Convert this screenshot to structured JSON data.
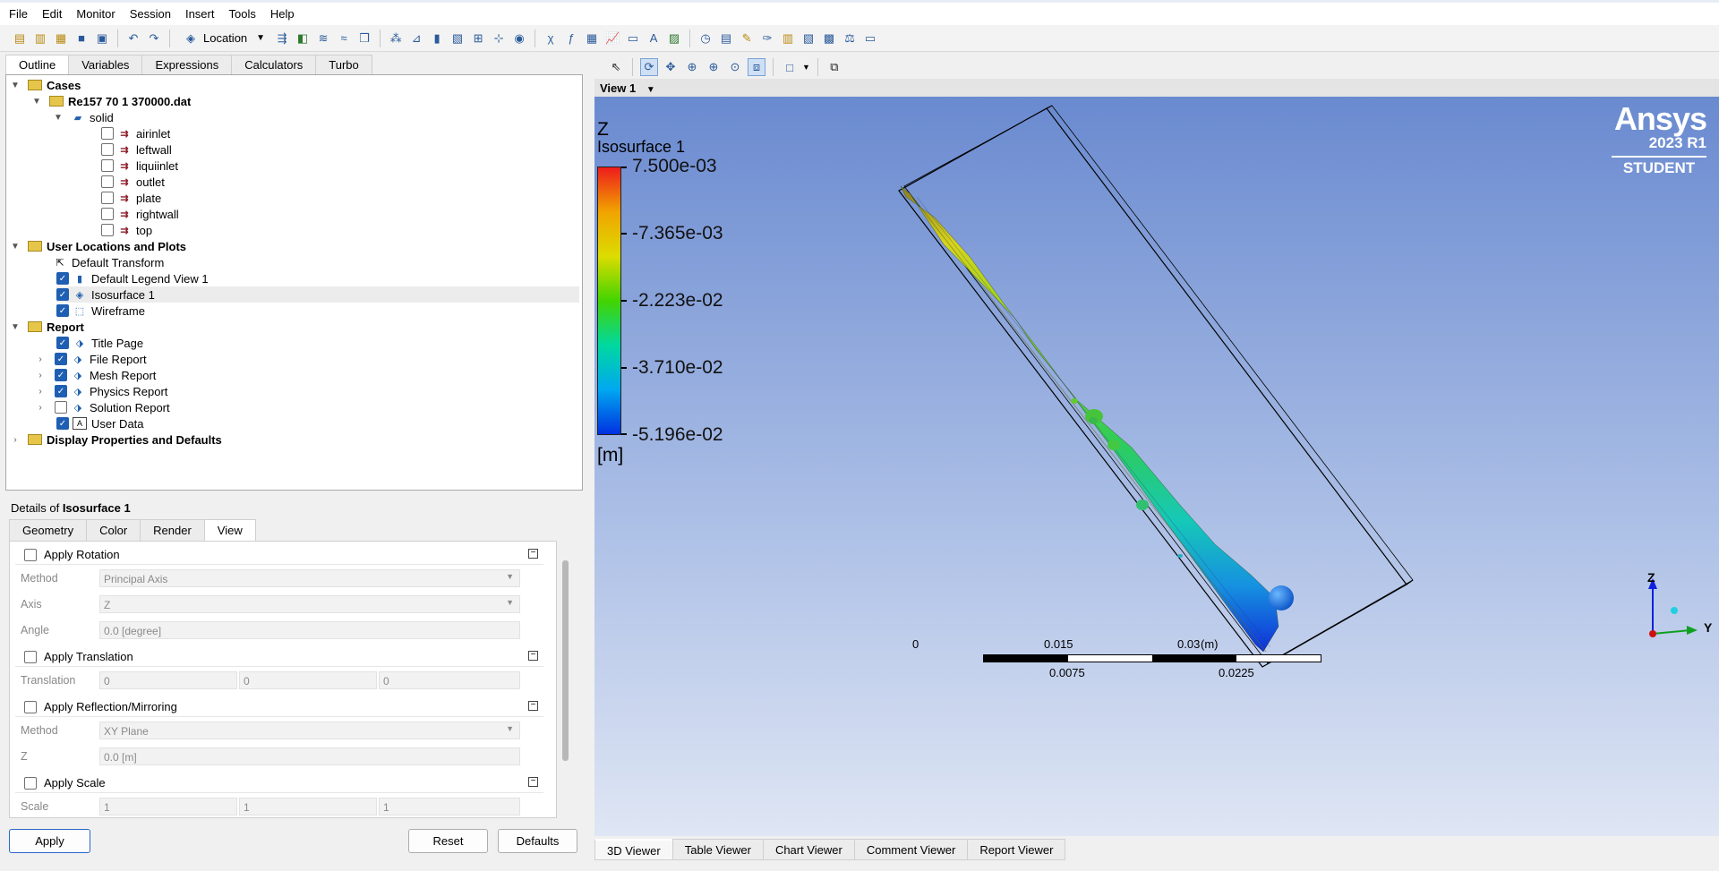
{
  "menu": [
    "File",
    "Edit",
    "Monitor",
    "Session",
    "Insert",
    "Tools",
    "Help"
  ],
  "toolbar": {
    "location_label": "Location"
  },
  "left_tabs": [
    "Outline",
    "Variables",
    "Expressions",
    "Calculators",
    "Turbo"
  ],
  "tree": {
    "cases": "Cases",
    "case_file": "Re157 70 1 370000.dat",
    "domain": "solid",
    "boundaries": [
      "airinlet",
      "leftwall",
      "liquiinlet",
      "outlet",
      "plate",
      "rightwall",
      "top"
    ],
    "user_locations": "User Locations and Plots",
    "default_transform": "Default Transform",
    "legend_view": "Default Legend View 1",
    "isosurface": "Isosurface 1",
    "wireframe": "Wireframe",
    "report": "Report",
    "report_items": [
      "Title Page",
      "File Report",
      "Mesh Report",
      "Physics Report",
      "Solution Report",
      "User Data"
    ],
    "display_props": "Display Properties and Defaults"
  },
  "details": {
    "title_prefix": "Details of ",
    "title_object": "Isosurface 1",
    "tabs": [
      "Geometry",
      "Color",
      "Render",
      "View"
    ],
    "apply_rotation": "Apply Rotation",
    "method_label": "Method",
    "method_value": "Principal Axis",
    "axis_label": "Axis",
    "axis_value": "Z",
    "angle_label": "Angle",
    "angle_value": "0.0 [degree]",
    "apply_translation": "Apply Translation",
    "translation_label": "Translation",
    "translation_values": [
      "0",
      "0",
      "0"
    ],
    "apply_reflection": "Apply Reflection/Mirroring",
    "refl_method_label": "Method",
    "refl_method_value": "XY Plane",
    "refl_z_label": "Z",
    "refl_z_value": "0.0 [m]",
    "apply_scale": "Apply Scale",
    "scale_label": "Scale",
    "scale_values": [
      "1",
      "1",
      "1"
    ],
    "apply_button": "Apply",
    "reset_button": "Reset",
    "defaults_button": "Defaults"
  },
  "viewer": {
    "view_label": "View 1",
    "legend_var": "Z",
    "legend_title": "Isosurface 1",
    "legend_ticks": [
      "7.500e-03",
      "-7.365e-03",
      "-2.223e-02",
      "-3.710e-02",
      "-5.196e-02"
    ],
    "legend_unit": "[m]",
    "brand": "Ansys",
    "version": "2023 R1",
    "edition": "STUDENT",
    "scale_top": [
      "0",
      "0.015",
      "0.03"
    ],
    "scale_unit": "(m)",
    "scale_bottom": [
      "0.0075",
      "0.0225"
    ],
    "axis_z": "Z",
    "axis_y": "Y",
    "tabs": [
      "3D Viewer",
      "Table Viewer",
      "Chart Viewer",
      "Comment Viewer",
      "Report Viewer"
    ]
  },
  "colors": {
    "accent": "#1f5fb3",
    "viewport_top": "#6a8ad0",
    "viewport_bottom": "#dfe6f4"
  }
}
